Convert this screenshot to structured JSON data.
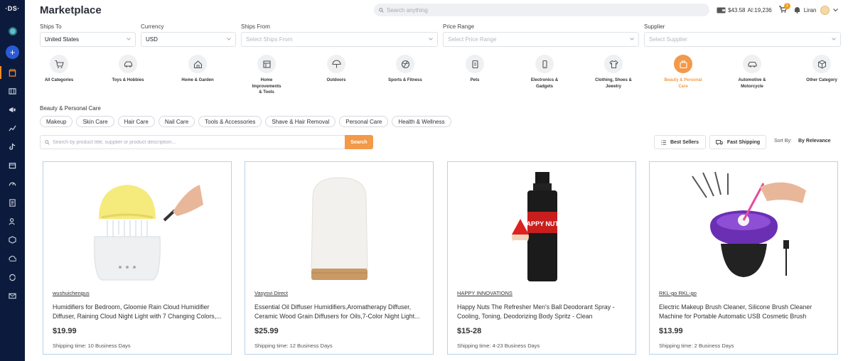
{
  "sidebar": {
    "logo": "·DS·",
    "items": [
      "store-icon",
      "chart-icon",
      "megaphone-icon",
      "analytics-icon",
      "tiktok-icon",
      "box-icon",
      "speed-icon",
      "orders-icon",
      "user-icon",
      "package-icon",
      "upload-icon",
      "sync-icon",
      "mail-icon"
    ]
  },
  "header": {
    "title": "Marketplace",
    "search_placeholder": "Search anything",
    "balance": "$43.58",
    "credits": "AI:19,236",
    "cart_count": "1",
    "user_name": "Liran"
  },
  "filters": {
    "ships_to": {
      "label": "Ships To",
      "value": "United States"
    },
    "currency": {
      "label": "Currency",
      "value": "USD"
    },
    "ships_from": {
      "label": "Ships From",
      "placeholder": "Select Ships From"
    },
    "price_range": {
      "label": "Price Range",
      "placeholder": "Select Price Range"
    },
    "supplier": {
      "label": "Supplier",
      "placeholder": "Select Supplier"
    }
  },
  "categories": [
    {
      "label": "All Categories",
      "icon": "cart-icon"
    },
    {
      "label": "Toys & Hobbies",
      "icon": "toy-car-icon"
    },
    {
      "label": "Home & Garden",
      "icon": "house-icon"
    },
    {
      "label": "Home Improvements & Tools",
      "icon": "tools-icon"
    },
    {
      "label": "Outdoors",
      "icon": "umbrella-icon"
    },
    {
      "label": "Sports & Fitness",
      "icon": "ball-icon"
    },
    {
      "label": "Pets",
      "icon": "pet-icon"
    },
    {
      "label": "Electronics & Gadgets",
      "icon": "phone-icon"
    },
    {
      "label": "Clothing, Shoes & Jewelry",
      "icon": "shirt-icon"
    },
    {
      "label": "Beauty & Personal Care",
      "icon": "beauty-icon",
      "active": true
    },
    {
      "label": "Automotive & Motorcycle",
      "icon": "car-icon"
    },
    {
      "label": "Other Category",
      "icon": "cube-icon"
    }
  ],
  "subcategory": {
    "title": "Beauty & Personal Care",
    "chips": [
      "Makeup",
      "Skin Care",
      "Hair Care",
      "Nail Care",
      "Tools & Accessories",
      "Shave & Hair Removal",
      "Personal Care",
      "Health & Wellness"
    ]
  },
  "product_search": {
    "placeholder": "Search by product title, supplier or product description...",
    "button": "Search"
  },
  "toolbar": {
    "best_sellers": "Best Sellers",
    "fast_shipping": "Fast Shipping",
    "sort_label": "Sort By:",
    "sort_value": "By Relevance"
  },
  "products": [
    {
      "supplier": "wushuichengus",
      "title": "Humidifiers for Bedroom, Gloomie Rain Cloud Humidifier Diffuser, Raining Cloud Night Light with 7 Changing Colors,...",
      "price": "$19.99",
      "shipping": "Shipping time: 10 Business Days"
    },
    {
      "supplier": "Vasysvi Direct",
      "title": "Essential Oil Diffuser Humidifiers,Aromatherapy Diffuser, Ceramic Wood Grain Diffusers for Oils,7-Color Night Light...",
      "price": "$25.99",
      "shipping": "Shipping time: 12 Business Days"
    },
    {
      "supplier": "HAPPY INNOVATIONS",
      "title": "Happy Nuts The Refresher Men's Ball Deodorant Spray - Cooling, Toning, Deodorizing Body Spritz - Clean Ingredients,...",
      "price": "$15-28",
      "shipping": "Shipping time: 4-23 Business Days"
    },
    {
      "supplier": "RKL-go RKL-go",
      "title": "Electric Makeup Brush Cleaner, Silicone Brush Cleaner Machine for Portable Automatic USB Cosmetic Brush Cleaner Tools,...",
      "price": "$13.99",
      "shipping": "Shipping time: 2 Business Days"
    }
  ],
  "product_images": {
    "p1": {
      "text": ""
    },
    "p3": {
      "text": "HAPPY NUTS"
    }
  },
  "colors": {
    "accent": "#f2994a",
    "sidebar": "#0c1b3d",
    "card_border": "#b9d2e8"
  }
}
